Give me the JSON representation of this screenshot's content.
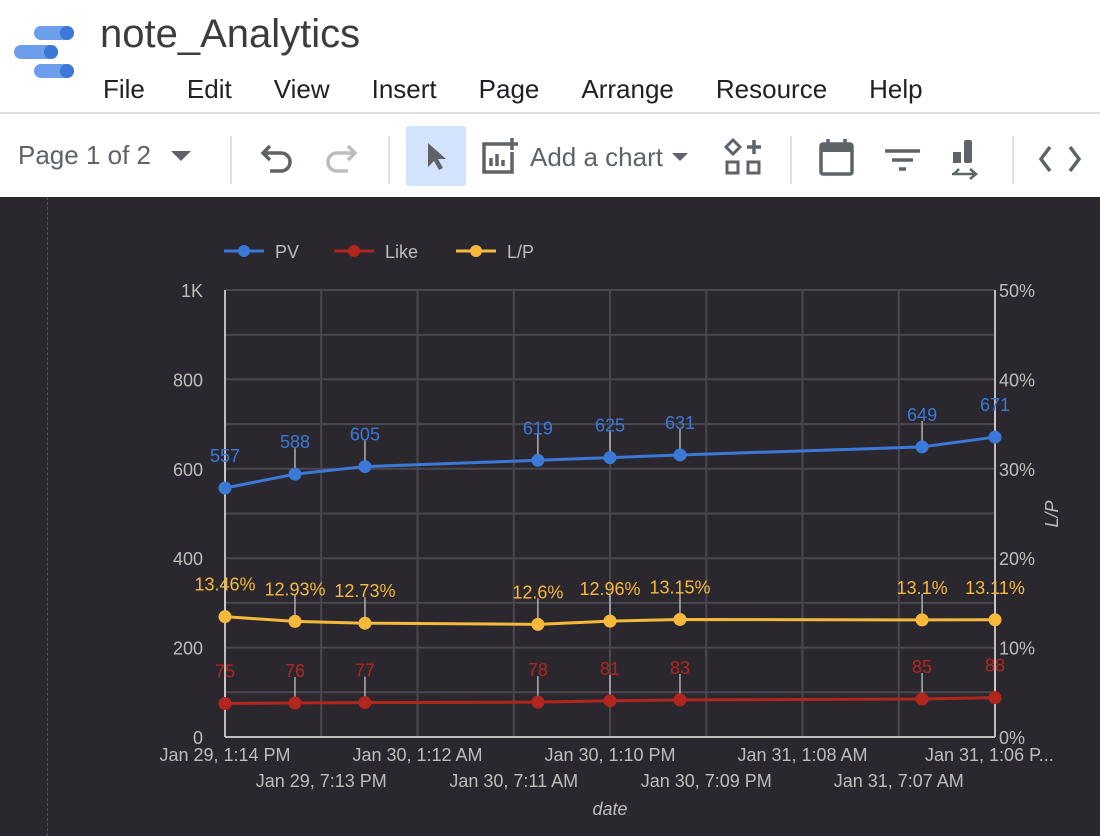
{
  "app": {
    "title": "note_Analytics",
    "logo": "looker-studio-logo"
  },
  "menu": [
    "File",
    "Edit",
    "View",
    "Insert",
    "Page",
    "Arrange",
    "Resource",
    "Help"
  ],
  "toolbar": {
    "page_selector": "Page 1 of 2",
    "add_chart": "Add a chart",
    "icons": [
      "undo-icon",
      "redo-icon",
      "select-cursor-icon",
      "add-chart-icon",
      "add-control-icon",
      "date-range-icon",
      "filter-icon",
      "data-blend-icon",
      "embed-code-icon"
    ]
  },
  "chart_data": {
    "type": "line",
    "legend": {
      "position": "top-left",
      "entries": [
        "PV",
        "Like",
        "L/P"
      ]
    },
    "colors": {
      "PV": "#3b78d8",
      "Like": "#b3261e",
      "L/P": "#f6b93b"
    },
    "x": [
      "2024-01-29T13:14",
      "2024-01-29T17:35",
      "2024-01-29T21:56",
      "2024-01-30T08:41",
      "2024-01-30T13:10",
      "2024-01-30T17:31",
      "2024-01-31T08:34",
      "2024-01-31T13:06"
    ],
    "series": [
      {
        "name": "PV",
        "axis": "left",
        "values": [
          557,
          588,
          605,
          619,
          625,
          631,
          649,
          671
        ],
        "labels": [
          "557",
          "588",
          "605",
          "619",
          "625",
          "631",
          "649",
          "671"
        ]
      },
      {
        "name": "Like",
        "axis": "left",
        "values": [
          75,
          76,
          77,
          78,
          81,
          83,
          85,
          88
        ],
        "labels": [
          "75",
          "76",
          "77",
          "78",
          "81",
          "83",
          "85",
          "88"
        ]
      },
      {
        "name": "L/P",
        "axis": "right",
        "values": [
          13.46,
          12.93,
          12.73,
          12.6,
          12.96,
          13.15,
          13.1,
          13.11
        ],
        "labels": [
          "13.46%",
          "12.93%",
          "12.73%",
          "12.6%",
          "12.96%",
          "13.15%",
          "13.1%",
          "13.11%"
        ]
      }
    ],
    "xlabel": "date",
    "ylabel_left": "",
    "ylabel_right": "L/P",
    "ylim_left": [
      0,
      1000
    ],
    "ylim_right": [
      0,
      50
    ],
    "yticks_left": [
      "0",
      "200",
      "400",
      "600",
      "800",
      "1K"
    ],
    "yticks_right": [
      "0%",
      "10%",
      "20%",
      "30%",
      "40%",
      "50%"
    ],
    "xticks": [
      "Jan 29, 1:14 PM",
      "Jan 29, 7:13 PM",
      "Jan 30, 1:12 AM",
      "Jan 30, 7:11 AM",
      "Jan 30, 1:10 PM",
      "Jan 30, 7:09 PM",
      "Jan 31, 1:08 AM",
      "Jan 31, 7:07 AM",
      "Jan 31, 1:06 P..."
    ],
    "grid": true
  }
}
